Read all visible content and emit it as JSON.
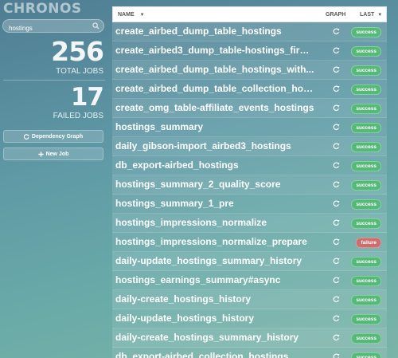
{
  "app": {
    "logo": "CHRONOS"
  },
  "search": {
    "value": "hostings"
  },
  "stats": {
    "total_jobs": "256",
    "total_label": "TOTAL JOBS",
    "failed_jobs": "17",
    "failed_label": "FAILED JOBS"
  },
  "buttons": {
    "dependency_graph": "Dependency Graph",
    "new_job": "New Job"
  },
  "table": {
    "headers": {
      "name": "NAME",
      "graph": "GRAPH",
      "last": "LAST"
    },
    "rows": [
      {
        "name": "create_airbed_dump_table_hostings",
        "status": "success"
      },
      {
        "name": "create_airbed3_dump_table-hostings_first...",
        "status": "success"
      },
      {
        "name": "create_airbed_dump_table_hostings_with...",
        "status": "success"
      },
      {
        "name": "create_airbed_dump_table_collection_hos...",
        "status": "success"
      },
      {
        "name": "create_omg_table-affiliate_events_hostings",
        "status": "success"
      },
      {
        "name": "hostings_summary",
        "status": "success"
      },
      {
        "name": "daily_gibson-import_airbed3_hostings",
        "status": "success"
      },
      {
        "name": "db_export-airbed_hostings",
        "status": "success"
      },
      {
        "name": "hostings_summary_2_quality_score",
        "status": "success"
      },
      {
        "name": "hostings_summary_1_pre",
        "status": "success"
      },
      {
        "name": "hostings_impressions_normalize",
        "status": "success"
      },
      {
        "name": "hostings_impressions_normalize_prepare",
        "status": "failure"
      },
      {
        "name": "daily-update_hostings_summary_history",
        "status": "success"
      },
      {
        "name": "hostings_earnings_summary#async",
        "status": "success"
      },
      {
        "name": "daily-create_hostings_history",
        "status": "success"
      },
      {
        "name": "daily-update_hostings_history",
        "status": "success"
      },
      {
        "name": "daily-create_hostings_summary_history",
        "status": "success"
      },
      {
        "name": "db_export-airbed_collection_hostings",
        "status": "success"
      }
    ]
  },
  "icons": {
    "search": "search-icon",
    "graph": "graph-icon",
    "dependency": "refresh-icon",
    "new": "plus-icon",
    "sort": "caret-down-icon"
  }
}
